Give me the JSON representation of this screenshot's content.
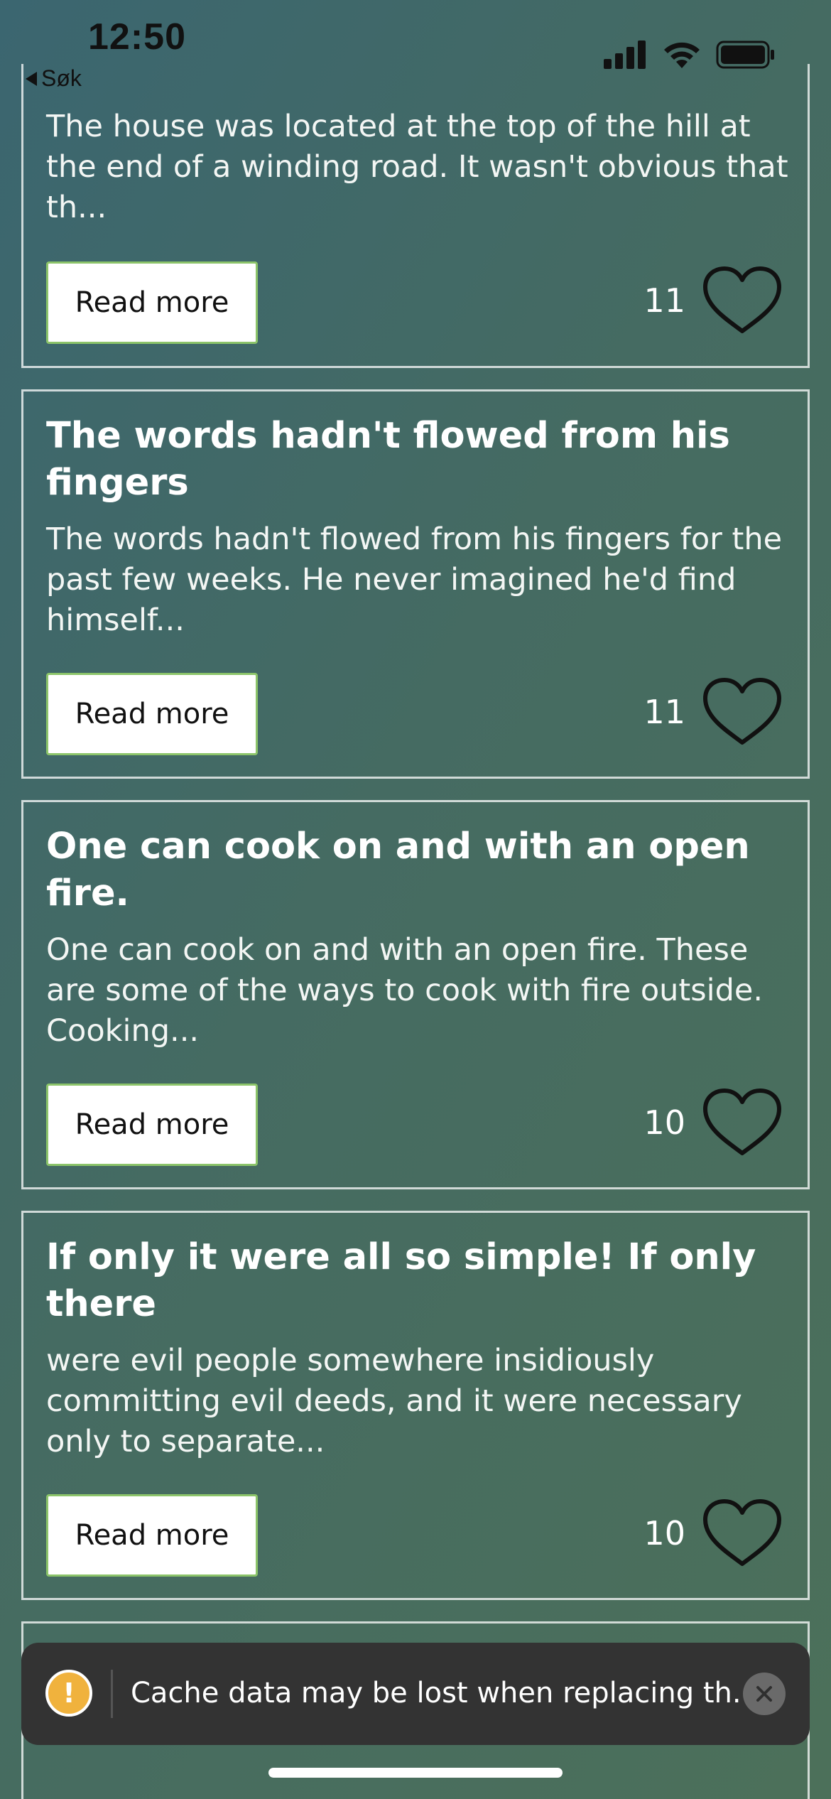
{
  "status_bar": {
    "time": "12:50",
    "back_label": "Søk",
    "icons": [
      "cellular-signal-icon",
      "wifi-icon",
      "battery-icon"
    ]
  },
  "cards": [
    {
      "title": "",
      "excerpt": "The house was located at the top of the hill at the end of a winding road. It wasn't obvious that th...",
      "button_label": "Read more",
      "likes": "11"
    },
    {
      "title": "The words hadn't flowed from his fingers",
      "excerpt": "The words hadn't flowed from his fingers for the past few weeks. He never imagined he'd find himself...",
      "button_label": "Read more",
      "likes": "11"
    },
    {
      "title": "One can cook on and with an open fire.",
      "excerpt": "One can cook on and with an open fire. These are some of the ways to cook with fire outside. Cooking...",
      "button_label": "Read more",
      "likes": "10"
    },
    {
      "title": "If only it were all so simple! If only there",
      "excerpt": "were evil people somewhere insidiously committing evil deeds, and it were necessary only to separate...",
      "button_label": "Read more",
      "likes": "10"
    }
  ],
  "toast": {
    "message": "Cache data may be lost when replacing th...",
    "icon": "warning-icon"
  },
  "colors": {
    "button_border": "#8cc46a",
    "toast_bg": "#333333",
    "warning": "#f0b23d"
  }
}
